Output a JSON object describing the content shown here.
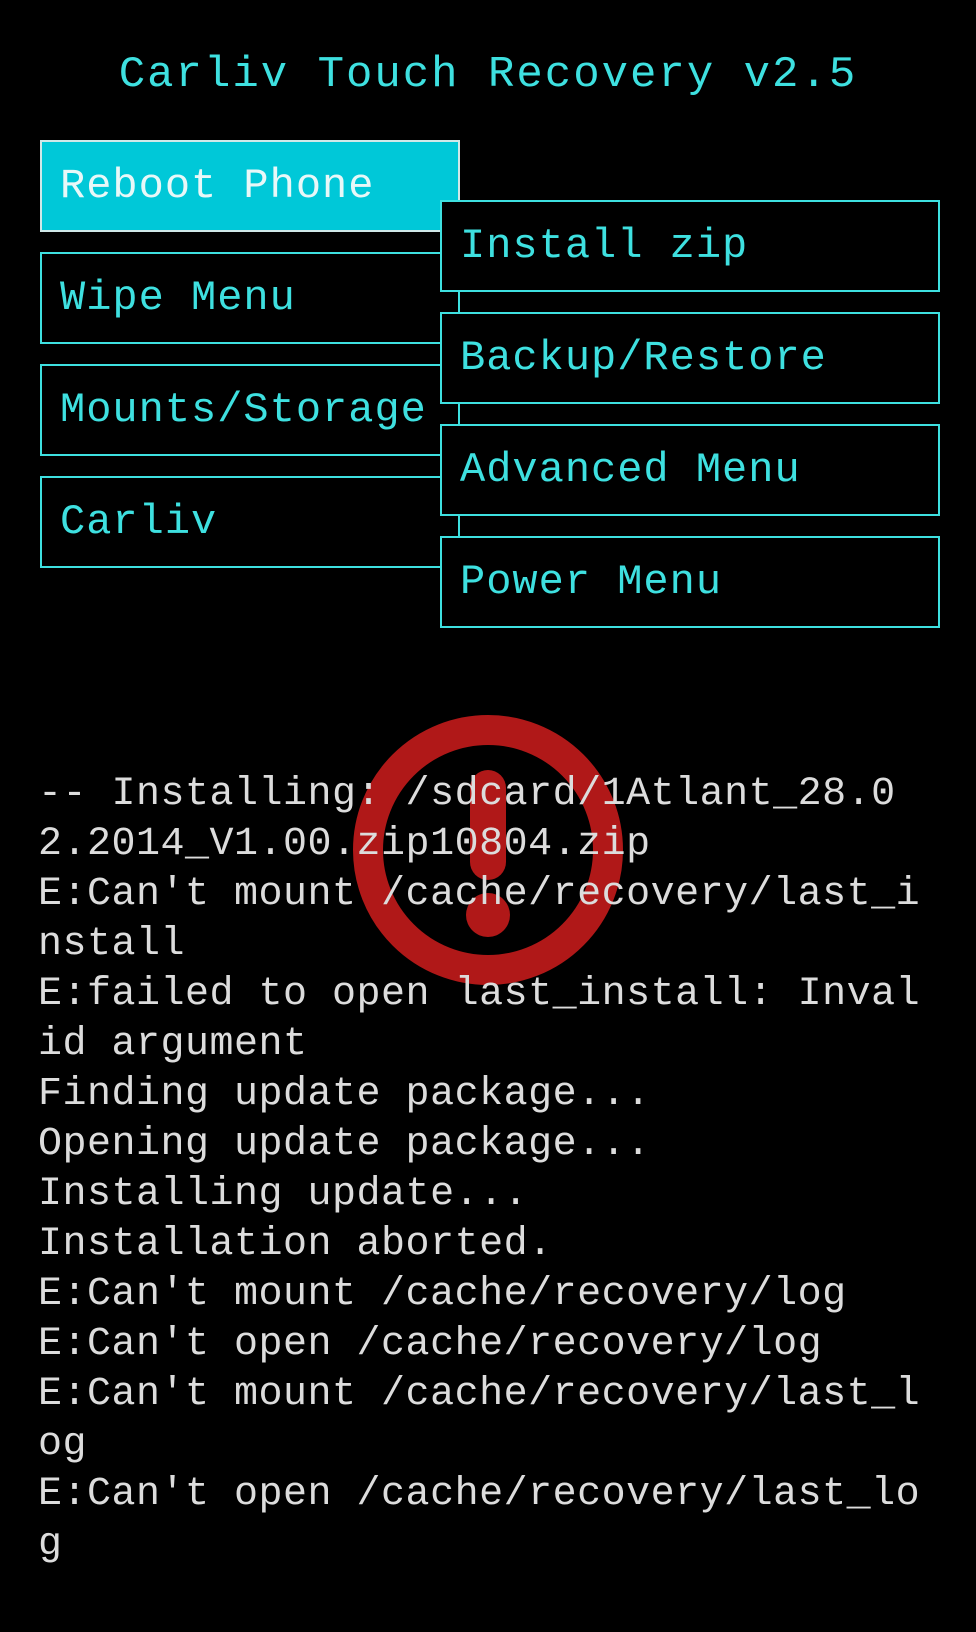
{
  "header": {
    "title": "Carliv Touch Recovery v2.5"
  },
  "menu": {
    "left": [
      {
        "label": "Reboot Phone",
        "selected": true
      },
      {
        "label": "Wipe Menu",
        "selected": false
      },
      {
        "label": "Mounts/Storage",
        "selected": false
      },
      {
        "label": "Carliv",
        "selected": false
      }
    ],
    "right": [
      {
        "label": "Install zip",
        "selected": false
      },
      {
        "label": "Backup/Restore",
        "selected": false
      },
      {
        "label": "Advanced Menu",
        "selected": false
      },
      {
        "label": "Power Menu",
        "selected": false
      }
    ]
  },
  "warning_icon": "exclamation-circle",
  "log": "-- Installing: /sdcard/1Atlant_28.02.2014_V1.00.zip10804.zip\nE:Can't mount /cache/recovery/last_install\nE:failed to open last_install: Invalid argument\nFinding update package...\nOpening update package...\nInstalling update...\nInstallation aborted.\nE:Can't mount /cache/recovery/log\nE:Can't open /cache/recovery/log\nE:Can't mount /cache/recovery/last_log\nE:Can't open /cache/recovery/last_log"
}
